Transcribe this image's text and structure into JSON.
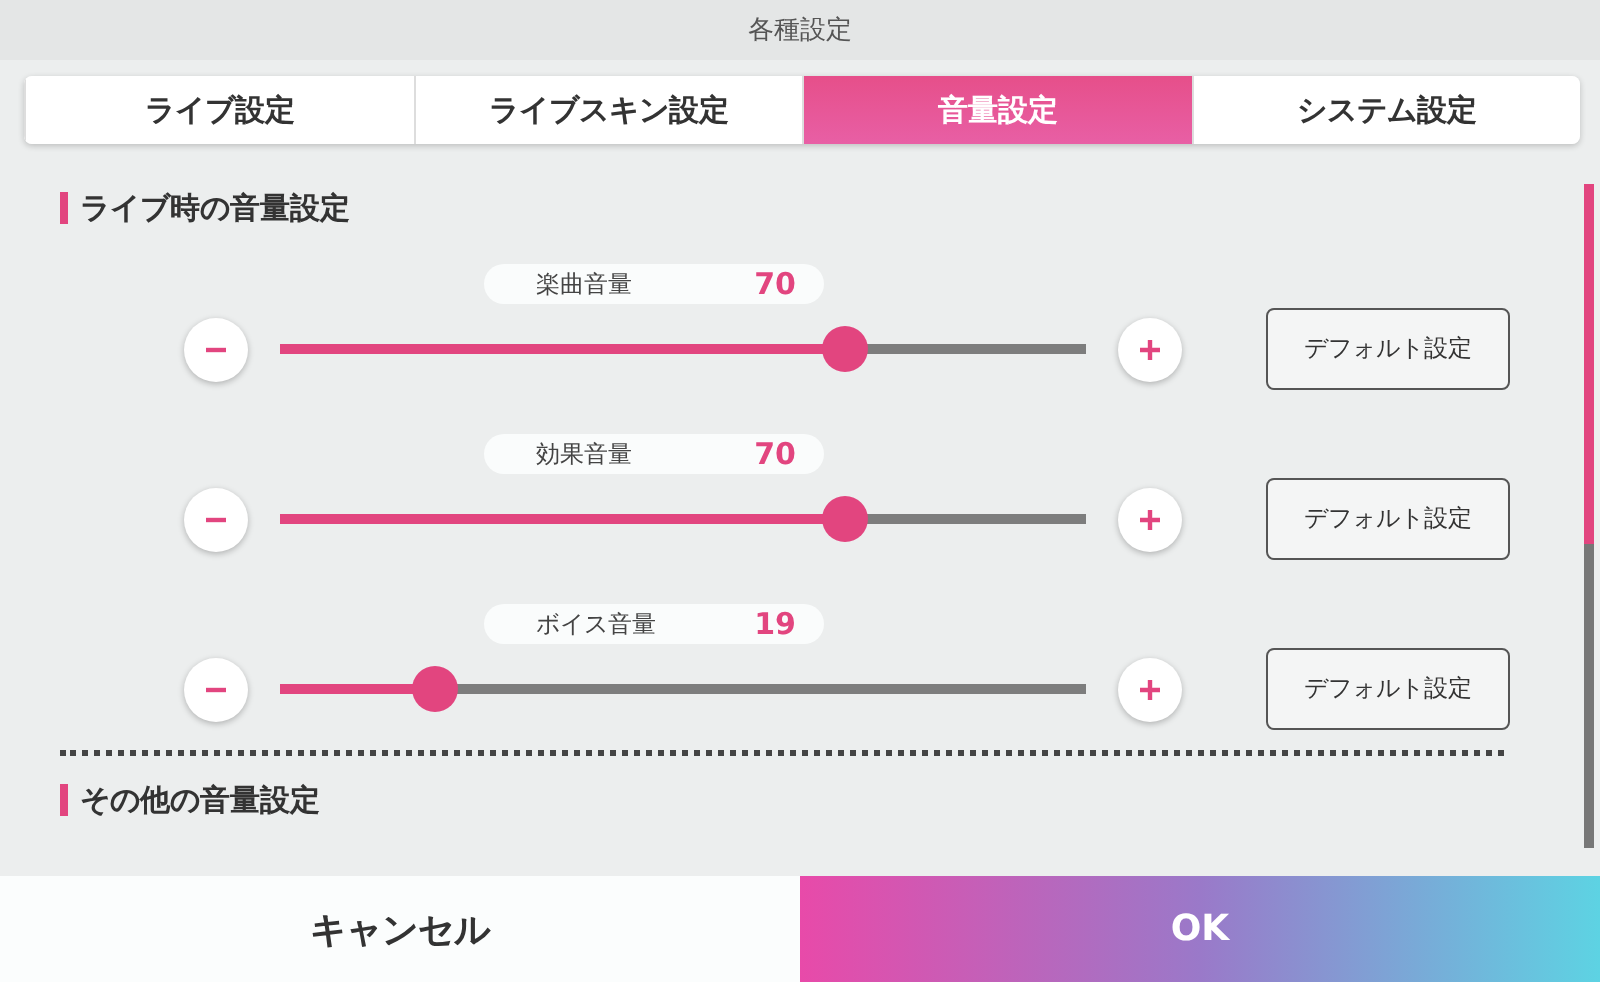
{
  "window": {
    "title": "各種設定"
  },
  "tabs": [
    {
      "label": "ライブ設定",
      "selected": false
    },
    {
      "label": "ライブスキン設定",
      "selected": false
    },
    {
      "label": "音量設定",
      "selected": true
    },
    {
      "label": "システム設定",
      "selected": false
    }
  ],
  "sections": [
    {
      "title": "ライブ時の音量設定",
      "sliders": [
        {
          "label": "楽曲音量",
          "reading": "70",
          "level": 0.7,
          "default_button": "デフォルト設定"
        },
        {
          "label": "効果音量",
          "reading": "70",
          "level": 0.7,
          "default_button": "デフォルト設定"
        },
        {
          "label": "ボイス音量",
          "reading": "19",
          "level": 0.19,
          "default_button": "デフォルト設定"
        }
      ]
    },
    {
      "title": "その他の音量設定"
    }
  ],
  "buttons": [
    {
      "label": "キャンセル",
      "kind": "cancel"
    },
    {
      "label": "OK",
      "kind": "ok"
    }
  ]
}
